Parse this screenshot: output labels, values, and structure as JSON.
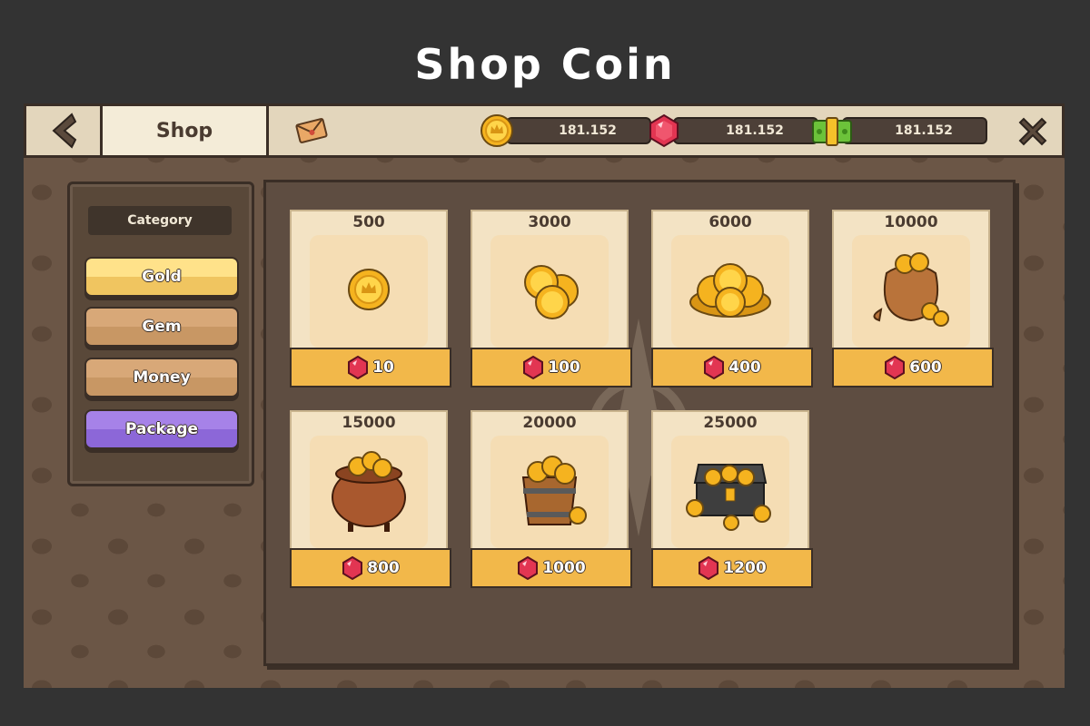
{
  "page": {
    "title": "Shop Coin"
  },
  "topbar": {
    "tab_label": "Shop",
    "currencies": [
      {
        "icon": "gold-coin-icon",
        "value": "181.152"
      },
      {
        "icon": "ruby-gem-icon",
        "value": "181.152"
      },
      {
        "icon": "cash-money-icon",
        "value": "181.152"
      }
    ]
  },
  "sidebar": {
    "title": "Category",
    "items": [
      {
        "label": "Gold",
        "selected": true
      },
      {
        "label": "Gem",
        "selected": false
      },
      {
        "label": "Money",
        "selected": false
      },
      {
        "label": "Package",
        "selected": false
      }
    ]
  },
  "shop": {
    "currency_icon": "ruby-gem-icon",
    "items": [
      {
        "amount": "500",
        "price": "10",
        "art": "single-coin"
      },
      {
        "amount": "3000",
        "price": "100",
        "art": "coin-stack-small"
      },
      {
        "amount": "6000",
        "price": "400",
        "art": "coin-pile"
      },
      {
        "amount": "10000",
        "price": "600",
        "art": "coin-sack"
      },
      {
        "amount": "15000",
        "price": "800",
        "art": "coin-pot"
      },
      {
        "amount": "20000",
        "price": "1000",
        "art": "coin-barrel"
      },
      {
        "amount": "25000",
        "price": "1200",
        "art": "treasure-chest"
      }
    ]
  },
  "colors": {
    "background": "#333333",
    "frame": "#6b5646",
    "price_button": "#f2b84a",
    "package_button": "#8c67d8",
    "gold_button": "#f0c560"
  }
}
